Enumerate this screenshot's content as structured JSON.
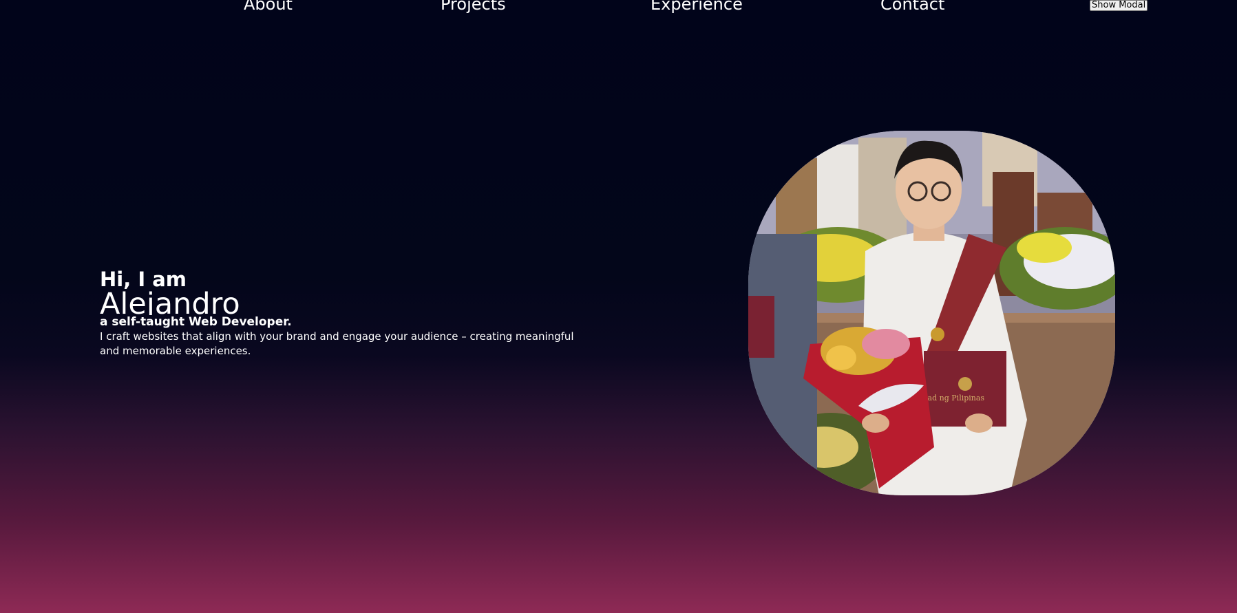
{
  "nav": {
    "items": [
      {
        "label": "About"
      },
      {
        "label": "Projects"
      },
      {
        "label": "Experience"
      },
      {
        "label": "Contact"
      }
    ],
    "modal_button": "Show Modal"
  },
  "hero": {
    "greeting": "Hi, I am",
    "name": "Alejandro",
    "role": "a self-taught Web Developer.",
    "description": "I craft websites that align with your brand and engage your audience – creating meaningful and memorable experiences."
  },
  "photo": {
    "icon": "profile-photo",
    "diploma_text": "idad ng Pilipinas"
  },
  "colors": {
    "background_top": "#01041a",
    "background_bottom": "#8e2a55",
    "text": "#ffffff"
  }
}
